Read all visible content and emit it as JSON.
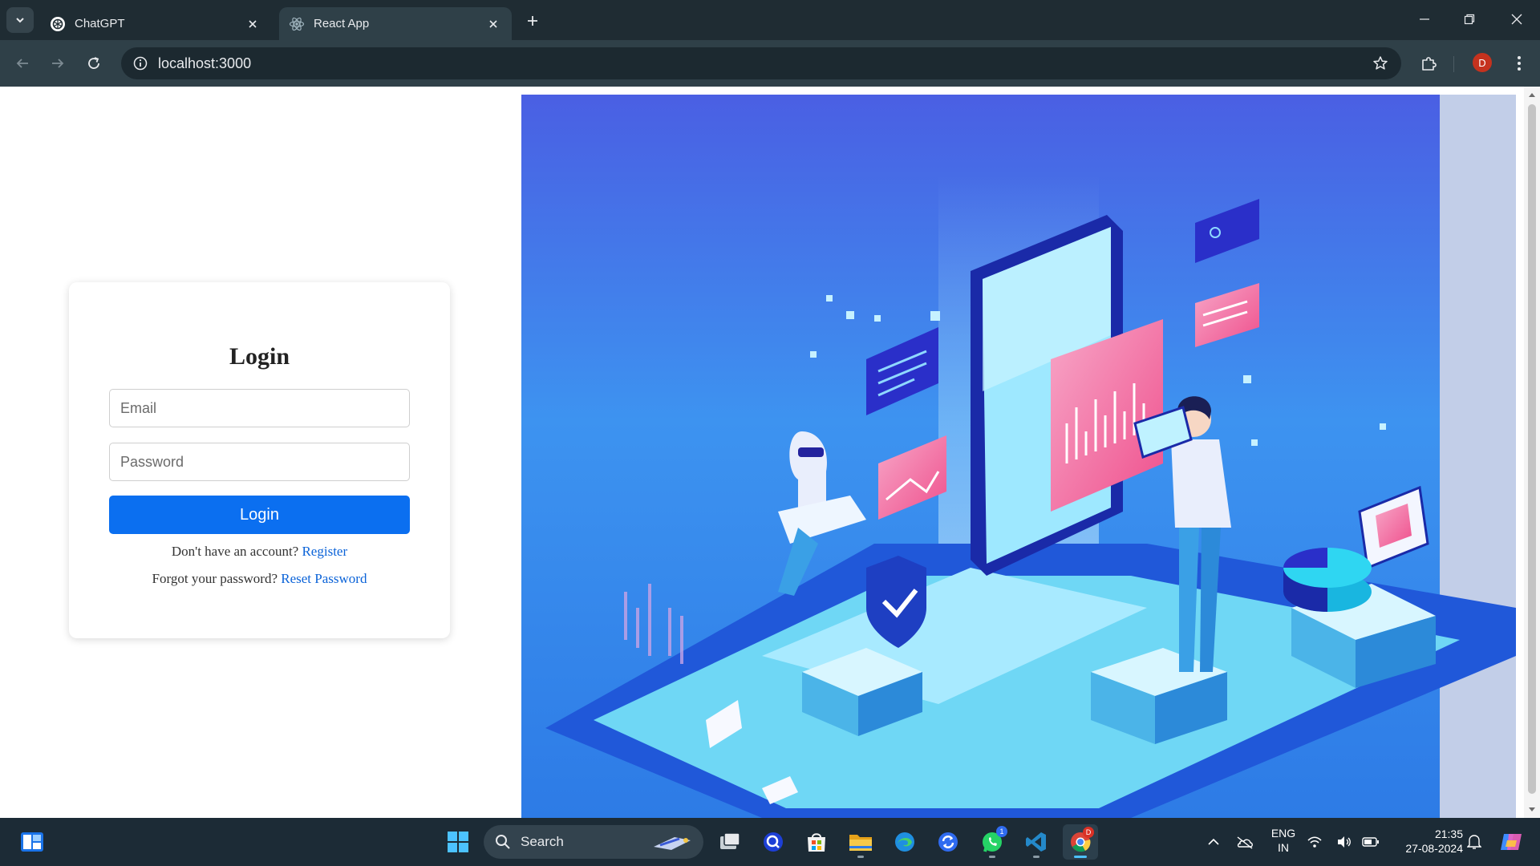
{
  "browser": {
    "tabs": [
      {
        "title": "ChatGPT",
        "active": false
      },
      {
        "title": "React App",
        "active": true
      }
    ],
    "url": "localhost:3000",
    "profile_initial": "D",
    "icons": [
      "tab-search-icon",
      "new-tab-icon",
      "minimize-icon",
      "restore-icon",
      "close-icon",
      "back-icon",
      "forward-icon",
      "reload-icon",
      "site-info-icon",
      "bookmark-star-icon",
      "extensions-icon",
      "menu-icon"
    ]
  },
  "login": {
    "title": "Login",
    "email_placeholder": "Email",
    "password_placeholder": "Password",
    "button_label": "Login",
    "register_prompt": "Don't have an account?",
    "register_link": "Register",
    "reset_prompt": "Forgot your password?",
    "reset_link": "Reset Password"
  },
  "hero": {
    "colors": {
      "top": "#4a5fe3",
      "mid": "#3d93f0",
      "bottom": "#2d7be6",
      "accent_pink": "#ef4f8c"
    }
  },
  "taskbar": {
    "search_label": "Search",
    "whatsapp_badge": "1",
    "chrome_badge": "D",
    "language_line1": "ENG",
    "language_line2": "IN",
    "time": "21:35",
    "date": "27-08-2024"
  }
}
